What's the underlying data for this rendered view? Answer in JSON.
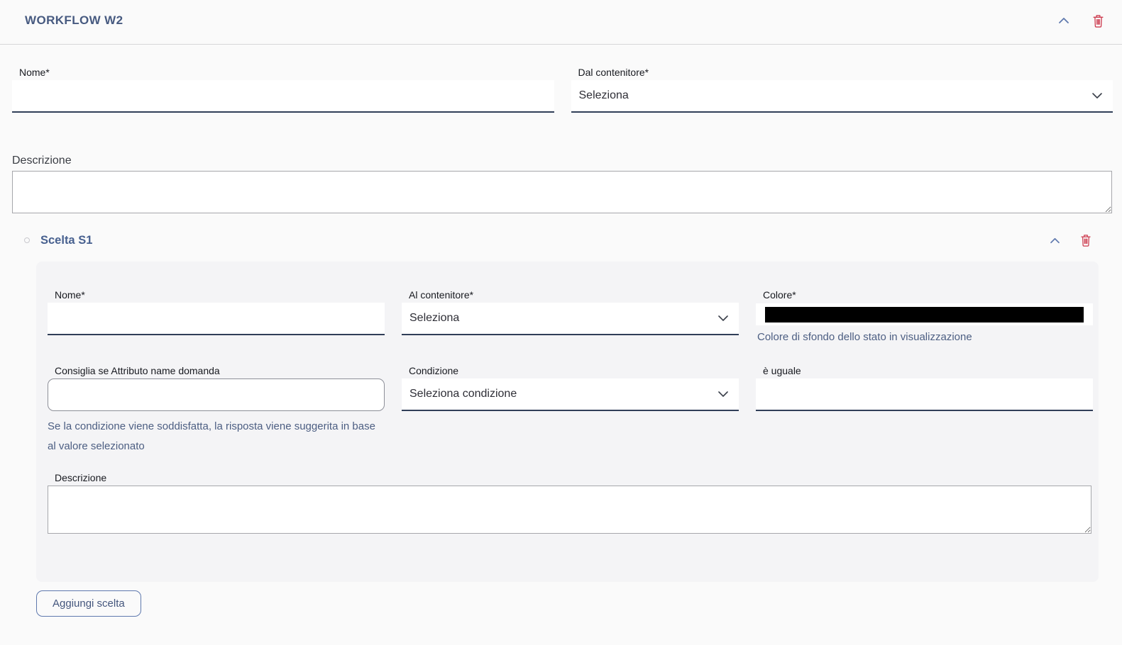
{
  "workflow_section": {
    "title": "WORKFLOW W2",
    "name_field": {
      "label": "Nome*",
      "value": ""
    },
    "container_field": {
      "label": "Dal contenitore*",
      "value": "Seleziona"
    },
    "description_field": {
      "label": "Descrizione",
      "value": ""
    }
  },
  "choice_section": {
    "title": "Scelta S1",
    "name_field": {
      "label": "Nome*",
      "value": ""
    },
    "container_field": {
      "label": "Al contenitore*",
      "value": "Seleziona"
    },
    "color_field": {
      "label": "Colore*",
      "value": "#000000",
      "helper": "Colore di sfondo dello stato in visualizzazione"
    },
    "suggest_field": {
      "label": "Consiglia se Attributo name domanda",
      "value": "",
      "helper": "Se la condizione viene soddisfatta, la risposta viene suggerita in base al valore selezionato"
    },
    "condition_field": {
      "label": "Condizione",
      "value": "Seleziona condizione"
    },
    "equals_field": {
      "label": "è uguale",
      "value": ""
    },
    "description_field": {
      "label": "Descrizione",
      "value": ""
    }
  },
  "actions": {
    "add_choice_label": "Aggiungi scelta"
  },
  "icons": {
    "collapse": "chevron-up-icon",
    "delete": "trash-icon",
    "dropdown": "chevron-down-icon"
  },
  "colors": {
    "heading_blue": "#475a80",
    "accent_blue": "#5f79ae",
    "danger_red": "#cd3d50",
    "underline_dark": "#303e58",
    "helper_blue": "#4c5e82",
    "panel_bg": "#f4f4f6",
    "page_bg": "#fafafa",
    "color_value": "#000000"
  }
}
